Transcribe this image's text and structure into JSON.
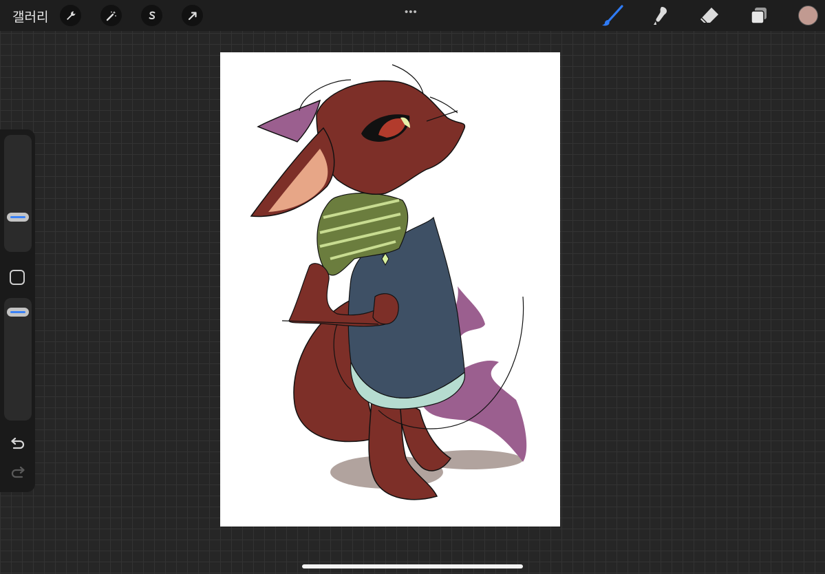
{
  "topbar": {
    "gallery_label": "갤러리",
    "left_tools": [
      "wrench-icon",
      "magic-wand-icon",
      "selection-s-icon",
      "transform-arrow-icon"
    ],
    "more_label": "•••",
    "right_tools": [
      "brush-icon",
      "smudge-icon",
      "eraser-icon",
      "layers-icon"
    ],
    "active_tool": "brush-icon",
    "accent_color": "#2f7bf5",
    "current_color": "#c19a91"
  },
  "sidebar": {
    "brush_size": 0.32,
    "brush_opacity": 0.93,
    "controls": [
      "brush-size-slider",
      "modify-button",
      "brush-opacity-slider",
      "undo-icon",
      "redo-icon"
    ]
  },
  "canvas": {
    "content": "illustration-fox-character",
    "background": "#ffffff"
  },
  "palette": {
    "fur": "#7d2f28",
    "ear_inner": "#e7a687",
    "shirt": "#6b7d3e",
    "overalls": "#3e5065",
    "shorts_light": "#b6dcd0",
    "tail_purple": "#9b5f8f",
    "shadow": "#a89993"
  }
}
